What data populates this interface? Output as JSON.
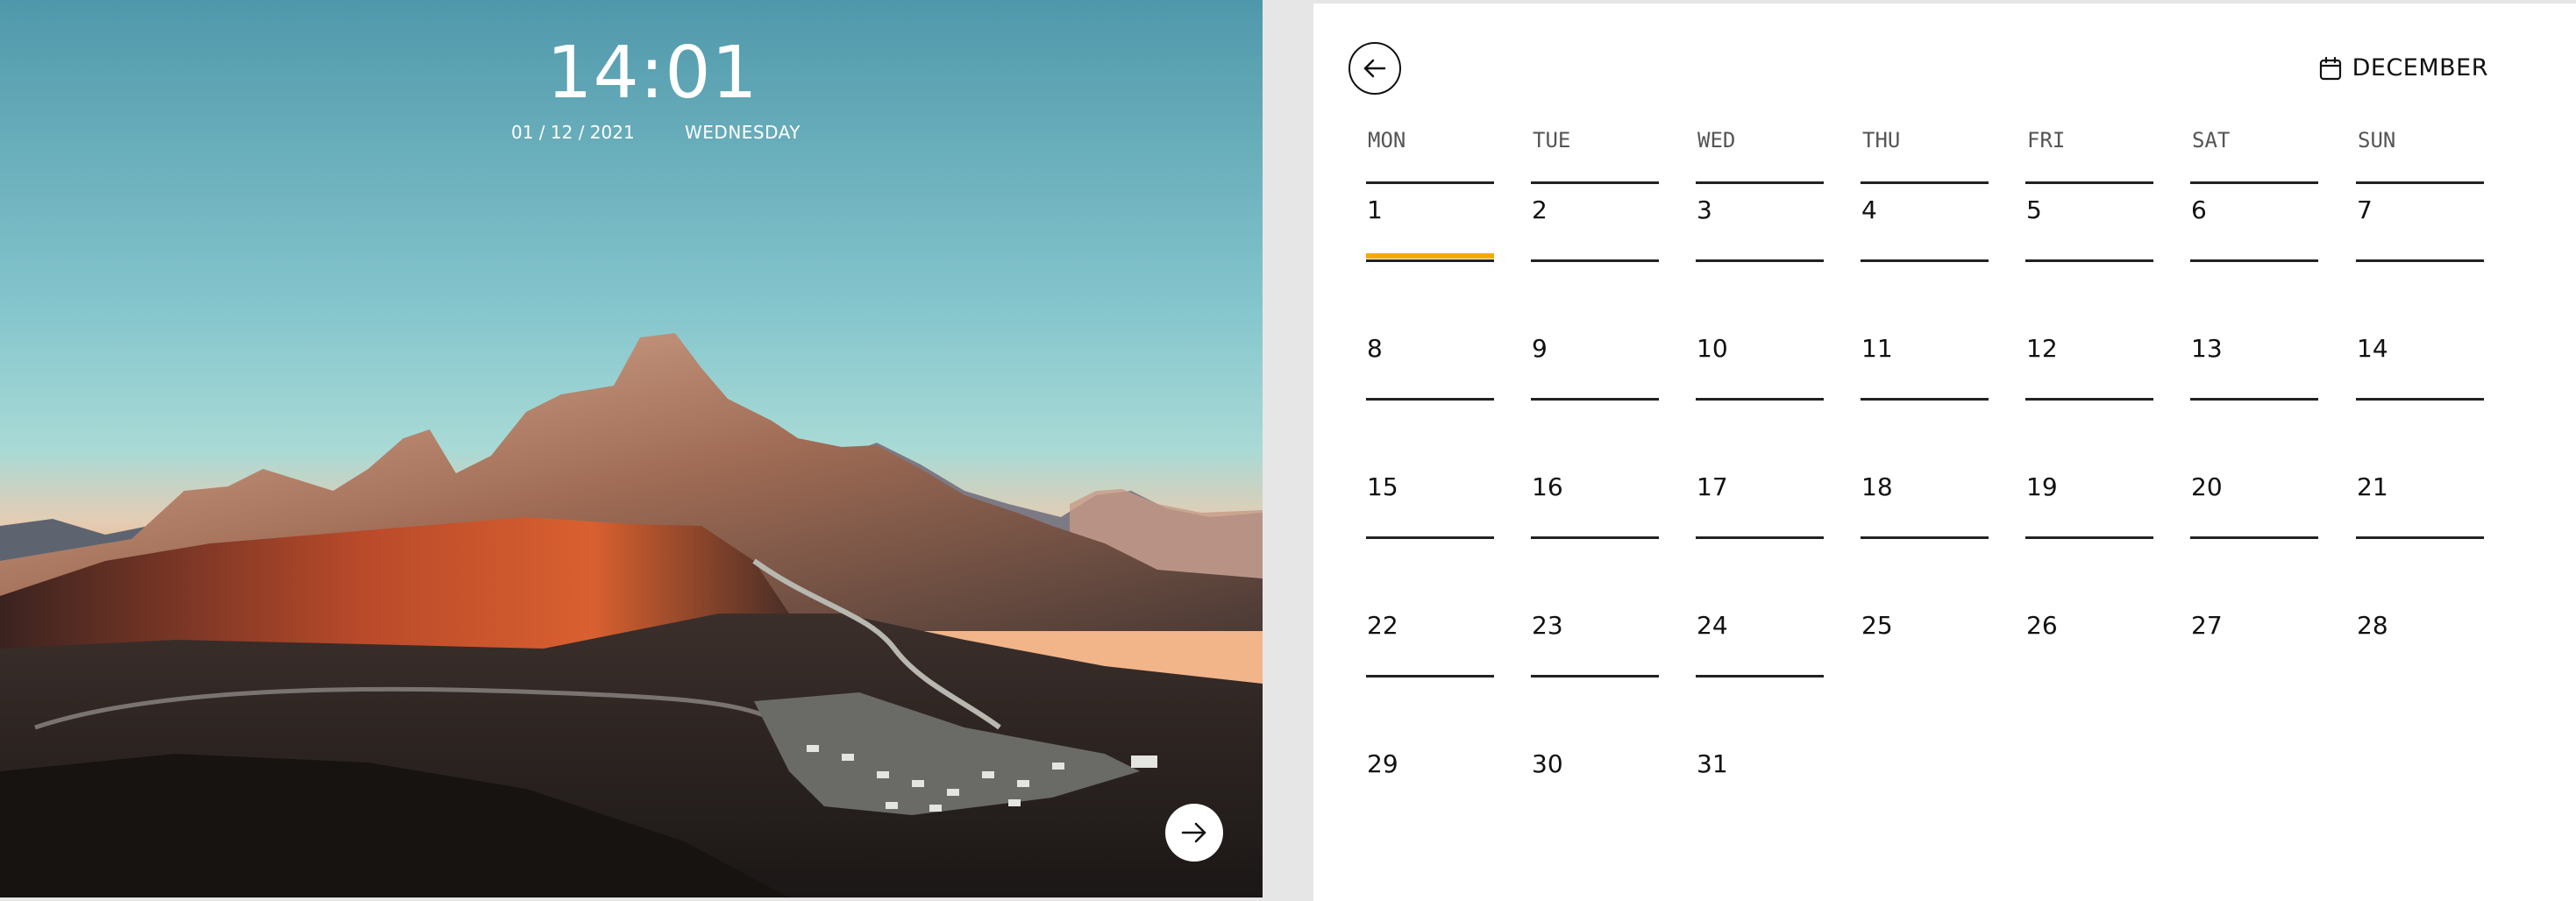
{
  "clock": {
    "time": "14:01",
    "date": "01 / 12 / 2021",
    "weekday": "WEDNESDAY"
  },
  "calendar": {
    "month": "DECEMBER",
    "weekdays": [
      "MON",
      "TUE",
      "WED",
      "THU",
      "FRI",
      "SAT",
      "SUN"
    ],
    "days": [
      "1",
      "2",
      "3",
      "4",
      "5",
      "6",
      "7",
      "8",
      "9",
      "10",
      "11",
      "12",
      "13",
      "14",
      "15",
      "16",
      "17",
      "18",
      "19",
      "20",
      "21",
      "22",
      "23",
      "24",
      "25",
      "26",
      "27",
      "28",
      "29",
      "30",
      "31"
    ],
    "selected_day": "1"
  },
  "colors": {
    "accent": "#f5a800",
    "ink": "#111111",
    "sky_top": "#4f98ab",
    "sky_bottom": "#f0b28a"
  },
  "icons": {
    "back": "arrow-left-icon",
    "next": "arrow-right-icon",
    "month": "calendar-icon"
  }
}
